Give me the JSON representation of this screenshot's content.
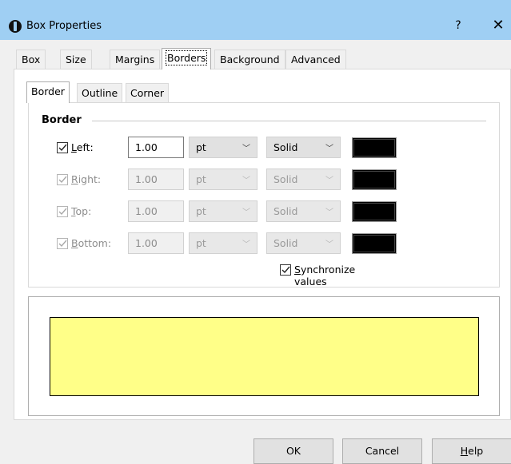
{
  "window": {
    "title": "Box Properties",
    "help_symbol": "?",
    "close_symbol": "✕",
    "app_icon": "info-icon"
  },
  "tabs": [
    "Box",
    "Size",
    "Margins",
    "Borders",
    "Background",
    "Advanced"
  ],
  "active_tab": "Borders",
  "subtabs": [
    "Border",
    "Outline",
    "Corner"
  ],
  "active_subtab": "Border",
  "border_group": {
    "title": "Border",
    "rows": [
      {
        "label_u": "L",
        "label_rest": "eft:",
        "checked": true,
        "enabled": true,
        "width": "1.00",
        "unit": "pt",
        "style": "Solid",
        "color": "#000000"
      },
      {
        "label_u": "R",
        "label_rest": "ight:",
        "checked": true,
        "enabled": false,
        "width": "1.00",
        "unit": "pt",
        "style": "Solid",
        "color": "#000000"
      },
      {
        "label_u": "T",
        "label_rest": "op:",
        "checked": true,
        "enabled": false,
        "width": "1.00",
        "unit": "pt",
        "style": "Solid",
        "color": "#000000"
      },
      {
        "label_u": "B",
        "label_rest": "ottom:",
        "checked": true,
        "enabled": false,
        "width": "1.00",
        "unit": "pt",
        "style": "Solid",
        "color": "#000000"
      }
    ],
    "synchronize": {
      "label_u": "S",
      "label_rest": "ynchronize values",
      "checked": true
    }
  },
  "preview": {
    "fill_color": "#ffff88",
    "border_color": "#000000"
  },
  "buttons": {
    "ok": "OK",
    "cancel": "Cancel",
    "help_u": "H",
    "help_rest": "elp"
  }
}
